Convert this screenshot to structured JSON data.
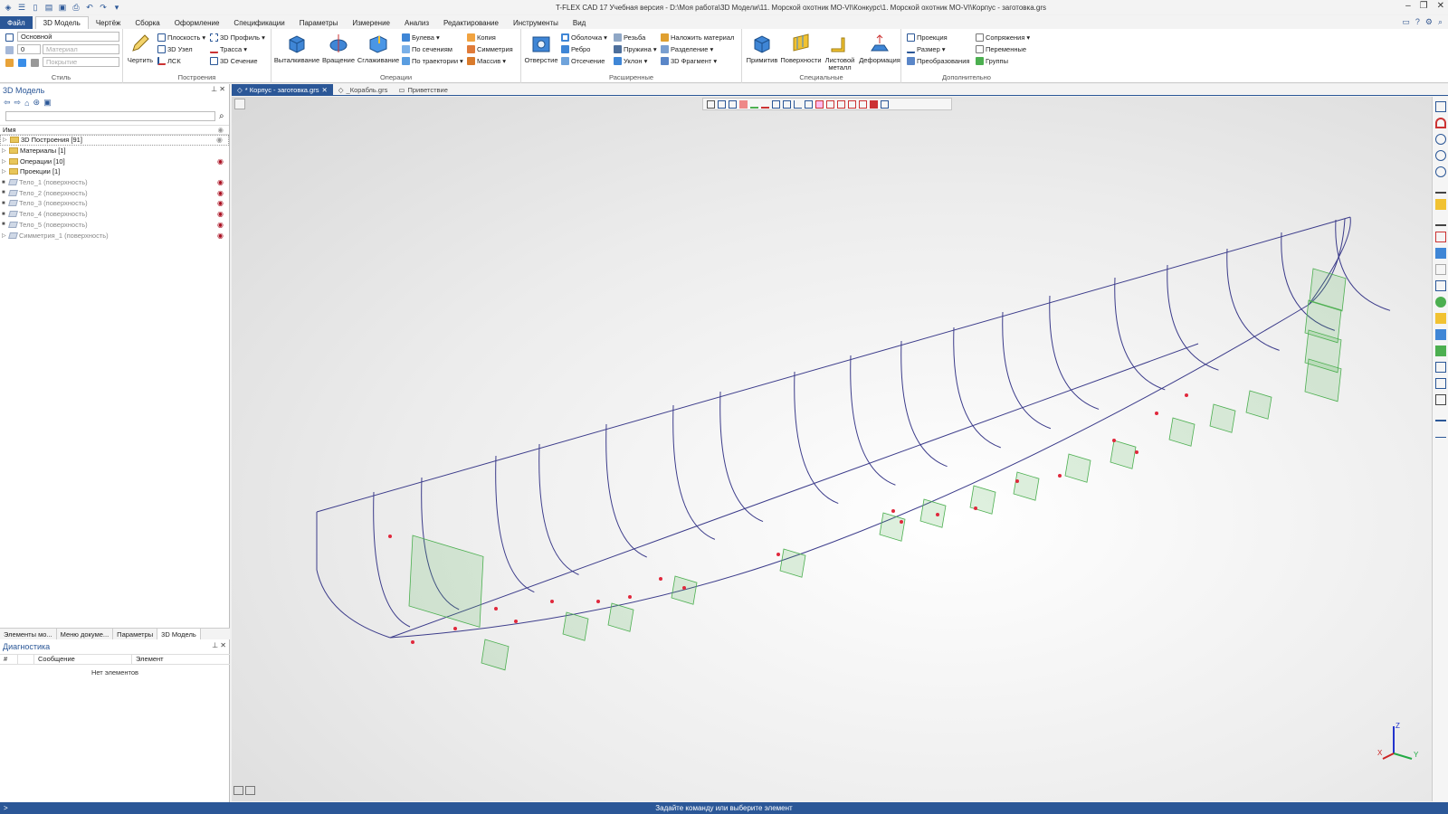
{
  "window": {
    "title": "T-FLEX CAD 17 Учебная версия - D:\\Моя работа\\3D Модели\\11. Морской охотник МО-VI\\Конкурс\\1. Морской охотник МО-VI\\Корпус - заготовка.grs"
  },
  "ribbon_tabs": [
    "Файл",
    "3D Модель",
    "Чертёж",
    "Сборка",
    "Оформление",
    "Спецификации",
    "Параметры",
    "Измерение",
    "Анализ",
    "Редактирование",
    "Инструменты",
    "Вид"
  ],
  "ribbon": {
    "style": {
      "layer": "Основной",
      "num": "0",
      "material": "Материал",
      "coating": "Покрытие",
      "label": "Стиль"
    },
    "constructions": {
      "draw": "Чертить",
      "plane": "Плоскость",
      "node": "3D Узел",
      "lsk": "ЛСК",
      "profile": "3D Профиль",
      "path": "Трасса",
      "section": "3D Сечение",
      "label": "Построения"
    },
    "operations": {
      "extrude": "Выталкивание",
      "revolve": "Вращение",
      "smooth": "Сглаживание",
      "boolean": "Булева",
      "loft": "По сечениям",
      "sweep": "По траектории",
      "copy": "Копия",
      "symmetry": "Симметрия",
      "array": "Массив",
      "label": "Операции"
    },
    "extended": {
      "hole": "Отверстие",
      "shell": "Оболочка",
      "rib": "Ребро",
      "cut": "Отсечение",
      "thread": "Резьба",
      "spring": "Пружина",
      "draft": "Уклон",
      "apply_material": "Наложить материал",
      "split": "Разделение",
      "fragment": "3D Фрагмент",
      "label": "Расширенные"
    },
    "special": {
      "primitive": "Примитив",
      "surfaces": "Поверхности",
      "sheet": "Листовой металл",
      "deform": "Деформация",
      "label": "Специальные"
    },
    "extra": {
      "projection": "Проекция",
      "size": "Размер",
      "transform": "Преобразования",
      "constraints": "Сопряжения",
      "variables": "Переменные",
      "groups": "Группы",
      "label": "Дополнительно"
    }
  },
  "model_panel": {
    "title": "3D Модель",
    "column": "Имя",
    "items": [
      {
        "label": "3D Построения [91]",
        "type": "folder"
      },
      {
        "label": "Материалы [1]",
        "type": "folder"
      },
      {
        "label": "Операции [10]",
        "type": "folder"
      },
      {
        "label": "Проекции [1]",
        "type": "folder"
      },
      {
        "label": "Тело_1 (поверхность)",
        "type": "body"
      },
      {
        "label": "Тело_2 (поверхность)",
        "type": "body"
      },
      {
        "label": "Тело_3 (поверхность)",
        "type": "body"
      },
      {
        "label": "Тело_4 (поверхность)",
        "type": "body"
      },
      {
        "label": "Тело_5 (поверхность)",
        "type": "body"
      },
      {
        "label": "Симметрия_1 (поверхность)",
        "type": "body"
      }
    ],
    "tabs": [
      "Элементы мо...",
      "Меню докуме...",
      "Параметры",
      "3D Модель"
    ]
  },
  "diagnostics": {
    "title": "Диагностика",
    "col_num": "#",
    "col_msg": "Сообщение",
    "col_el": "Элемент",
    "empty": "Нет элементов"
  },
  "doc_tabs": [
    "* Корпус - заготовка.grs",
    "_Корабль.grs",
    "Приветствие"
  ],
  "status": {
    "prompt": ">",
    "text": "Задайте команду или выберите элемент"
  },
  "axes": {
    "x": "X",
    "y": "Y",
    "z": "Z"
  },
  "colors": {
    "accent": "#2b5797",
    "wire": "#3b3b8a",
    "plane": "#4caf50",
    "point": "#e0283c"
  }
}
